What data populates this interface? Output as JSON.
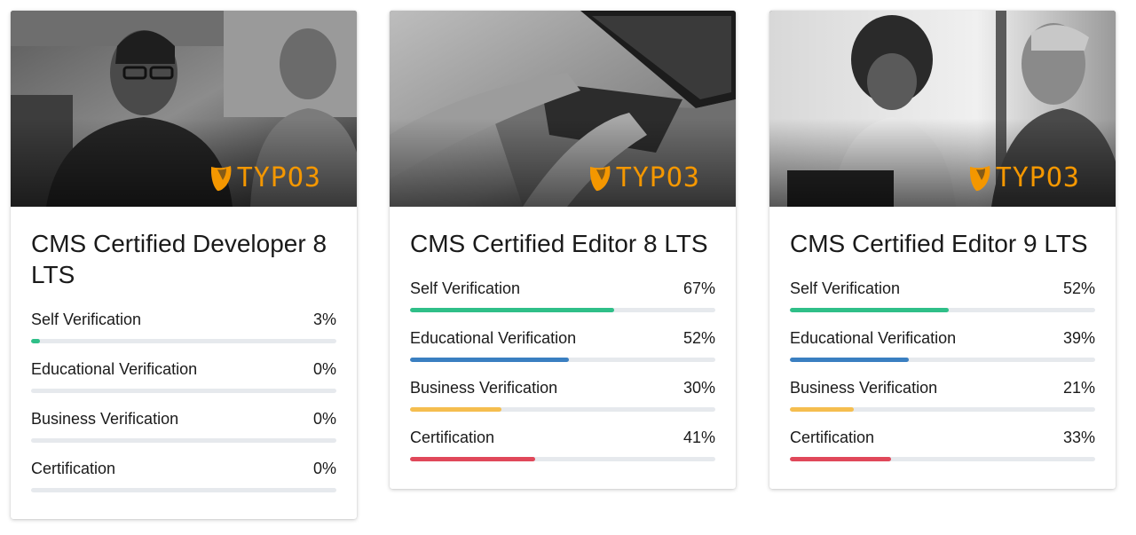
{
  "logo_text": "TYPO3",
  "colors": {
    "self": "#2fbf88",
    "educational": "#3a7fc1",
    "business": "#f5be4f",
    "certification": "#e0485a",
    "brand": "#f49700"
  },
  "cards": [
    {
      "title": "CMS Certified Developer 8 LTS",
      "image": "two-developers-photo",
      "rows": [
        {
          "label": "Self Verification",
          "value": "3%",
          "fraction": 0.03
        },
        {
          "label": "Educational Verification",
          "value": "0%",
          "fraction": 0
        },
        {
          "label": "Business Verification",
          "value": "0%",
          "fraction": 0
        },
        {
          "label": "Certification",
          "value": "0%",
          "fraction": 0
        }
      ]
    },
    {
      "title": "CMS Certified Editor 8 LTS",
      "image": "laptop-typing-photo",
      "rows": [
        {
          "label": "Self Verification",
          "value": "67%",
          "fraction": 0.67
        },
        {
          "label": "Educational Verification",
          "value": "52%",
          "fraction": 0.52
        },
        {
          "label": "Business Verification",
          "value": "30%",
          "fraction": 0.3
        },
        {
          "label": "Certification",
          "value": "41%",
          "fraction": 0.41
        }
      ]
    },
    {
      "title": "CMS Certified Editor 9 LTS",
      "image": "two-colleagues-smiling-photo",
      "rows": [
        {
          "label": "Self Verification",
          "value": "52%",
          "fraction": 0.52
        },
        {
          "label": "Educational Verification",
          "value": "39%",
          "fraction": 0.39
        },
        {
          "label": "Business Verification",
          "value": "21%",
          "fraction": 0.21
        },
        {
          "label": "Certification",
          "value": "33%",
          "fraction": 0.33
        }
      ]
    }
  ]
}
